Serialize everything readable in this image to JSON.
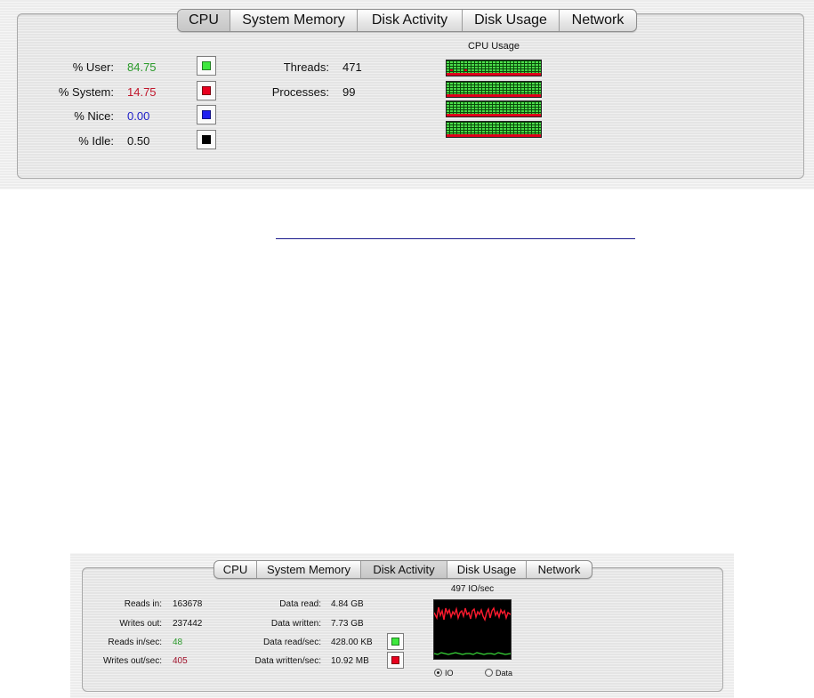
{
  "tabs": [
    "CPU",
    "System Memory",
    "Disk Activity",
    "Disk Usage",
    "Network"
  ],
  "cpu_panel": {
    "active_tab": "CPU",
    "rows": [
      {
        "label": "% User:",
        "value": "84.75",
        "color": "#2a9a2a"
      },
      {
        "label": "% System:",
        "value": "14.75",
        "color": "#c0152a"
      },
      {
        "label": "% Nice:",
        "value": "0.00",
        "color": "#2020c8"
      },
      {
        "label": "% Idle:",
        "value": "0.50",
        "color": "#111111"
      }
    ],
    "swatches": [
      "#3ee83e",
      "#e8001e",
      "#2020f0",
      "#000000"
    ],
    "threads_label": "Threads:",
    "threads_value": "471",
    "processes_label": "Processes:",
    "processes_value": "99",
    "meter_title": "CPU Usage",
    "meters": [
      {
        "user_fraction": 0.85,
        "system_fraction": 0.15
      },
      {
        "user_fraction": 0.85,
        "system_fraction": 0.15
      },
      {
        "user_fraction": 0.85,
        "system_fraction": 0.15
      },
      {
        "user_fraction": 0.85,
        "system_fraction": 0.15
      }
    ]
  },
  "disk_panel": {
    "active_tab": "Disk Activity",
    "left_rows": [
      {
        "label": "Reads in:",
        "value": "163678",
        "color": "#111111"
      },
      {
        "label": "Writes out:",
        "value": "237442",
        "color": "#111111"
      },
      {
        "label": "Reads in/sec:",
        "value": "48",
        "color": "#2a9a2a"
      },
      {
        "label": "Writes out/sec:",
        "value": "405",
        "color": "#a0102a"
      }
    ],
    "right_rows": [
      {
        "label": "Data read:",
        "value": "4.84 GB"
      },
      {
        "label": "Data written:",
        "value": "7.73 GB"
      },
      {
        "label": "Data read/sec:",
        "value": "428.00 KB"
      },
      {
        "label": "Data written/sec:",
        "value": "10.92 MB"
      }
    ],
    "swatches": [
      "#3ee83e",
      "#e8001e"
    ],
    "graph_title": "497 IO/sec",
    "radio_io": "IO",
    "radio_data": "Data",
    "selected_radio": "IO",
    "colors": {
      "write_line": "#ff1a2e",
      "read_line": "#38d838",
      "graph_bg": "#000000"
    }
  }
}
